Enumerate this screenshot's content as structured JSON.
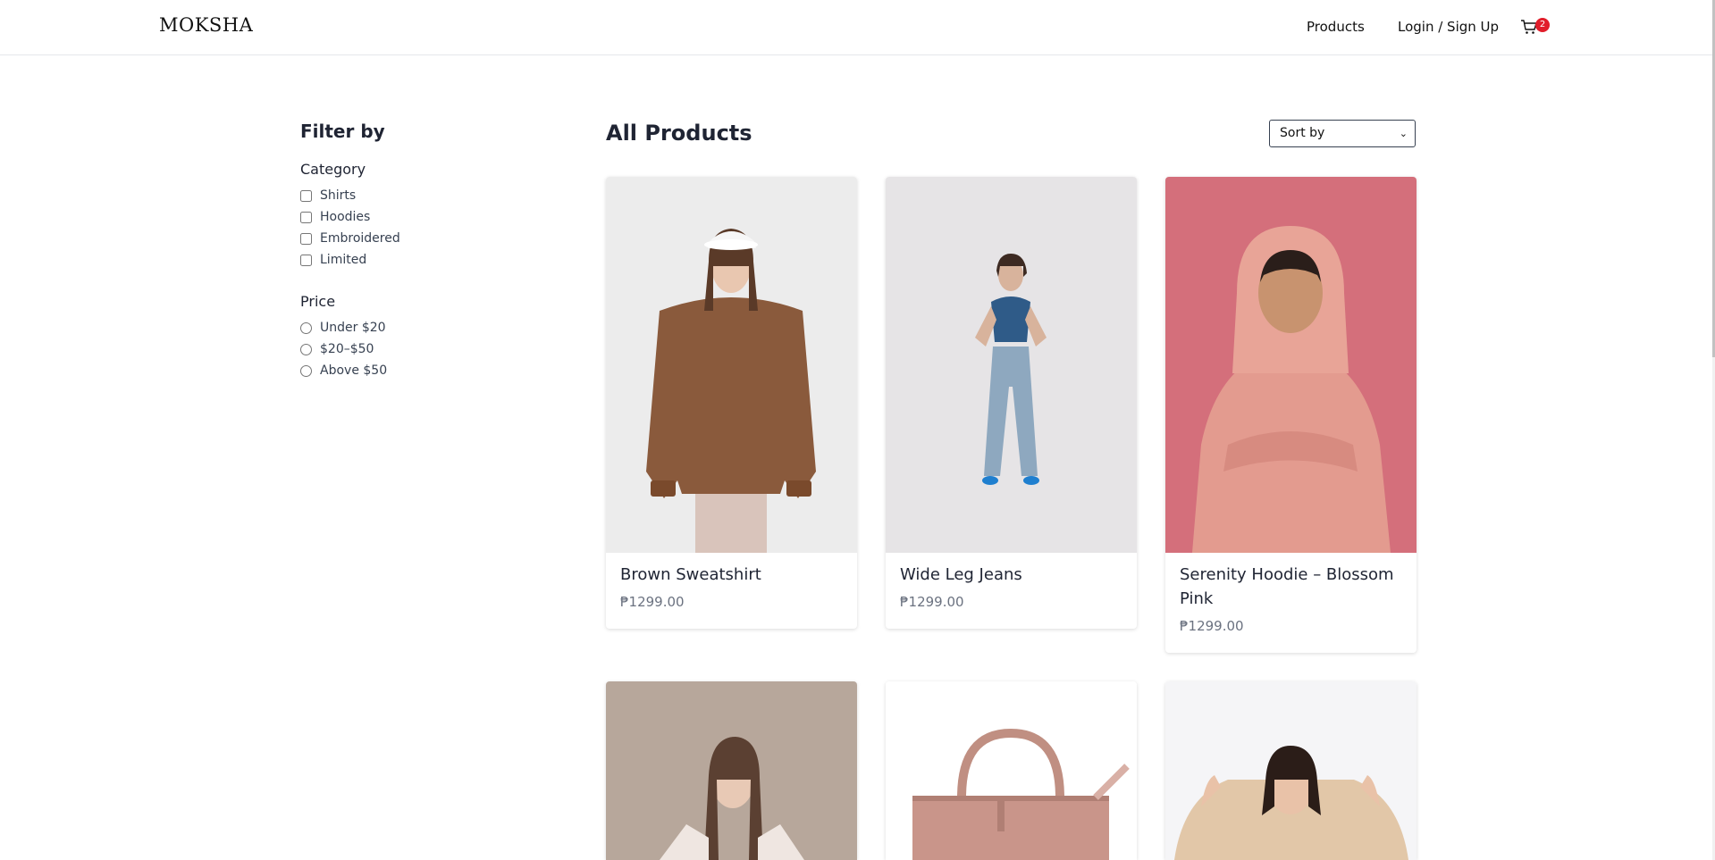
{
  "header": {
    "brand": "MOKSHA",
    "nav_products": "Products",
    "nav_login": "Login / Sign Up",
    "cart_icon": "cart-icon",
    "cart_count": "2"
  },
  "sidebar": {
    "title": "Filter by",
    "category_title": "Category",
    "categories": [
      "Shirts",
      "Hoodies",
      "Embroidered",
      "Limited"
    ],
    "price_title": "Price",
    "prices": [
      "Under $20",
      "$20–$50",
      "Above $50"
    ]
  },
  "main": {
    "title": "All Products",
    "sort_placeholder": "Sort by",
    "products": [
      {
        "name": "Brown Sweatshirt",
        "price": "₱1299.00"
      },
      {
        "name": "Wide Leg Jeans",
        "price": "₱1299.00"
      },
      {
        "name": "Serenity Hoodie – Blossom Pink",
        "price": "₱1299.00"
      },
      {
        "name": "",
        "price": ""
      },
      {
        "name": "",
        "price": ""
      },
      {
        "name": "",
        "price": ""
      }
    ]
  },
  "colors": {
    "badge": "#e11d2a",
    "text": "#1f2433",
    "price": "#6b7280"
  }
}
